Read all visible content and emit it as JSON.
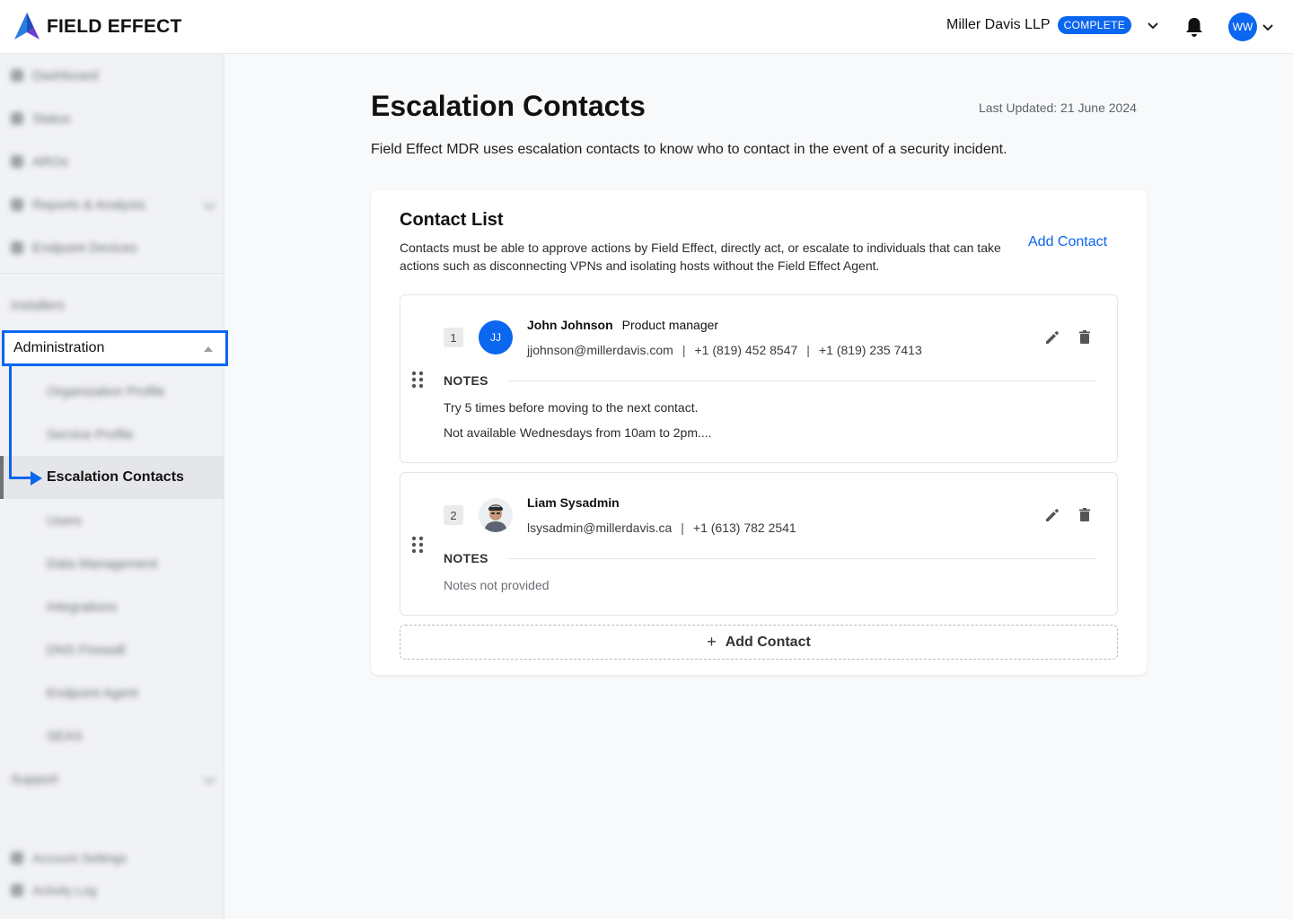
{
  "brand": {
    "name": "FIELD EFFECT"
  },
  "header": {
    "org_name": "Miller Davis LLP",
    "org_status": "COMPLETE",
    "user_initials": "WW",
    "icons": [
      "chevron-down-icon",
      "bell-icon"
    ]
  },
  "sidebar": {
    "top_items": [
      {
        "label": "Dashboard",
        "icon": "grid-icon"
      },
      {
        "label": "Status",
        "icon": "status-icon"
      },
      {
        "label": "AROs",
        "icon": "alert-icon"
      },
      {
        "label": "Reports & Analysis",
        "icon": "report-icon"
      },
      {
        "label": "Endpoint Devices",
        "icon": "device-icon"
      }
    ],
    "installers": "Installers",
    "administration": "Administration",
    "admin_items": [
      {
        "label": "Organization Profile"
      },
      {
        "label": "Service Profile"
      },
      {
        "label": "Escalation Contacts"
      },
      {
        "label": "Users"
      },
      {
        "label": "Data Management"
      },
      {
        "label": "Integrations"
      },
      {
        "label": "DNS Firewall"
      },
      {
        "label": "Endpoint Agent"
      },
      {
        "label": "SEAS"
      }
    ],
    "support": "Support",
    "bottom_items": [
      {
        "label": "Account Settings",
        "icon": "user-icon"
      },
      {
        "label": "Activity Log",
        "icon": "activity-icon"
      }
    ]
  },
  "page": {
    "title": "Escalation Contacts",
    "last_updated": "Last Updated: 21 June 2024",
    "description": "Field Effect MDR uses escalation contacts to know who to contact in the event of a security incident."
  },
  "contact_list": {
    "title": "Contact List",
    "description": "Contacts must be able to approve actions by Field Effect, directly act, or escalate to individuals that can take actions such as disconnecting VPNs and isolating hosts without the Field Effect Agent.",
    "add_link": "Add Contact",
    "add_button": "Add Contact",
    "notes_header": "NOTES",
    "contacts": [
      {
        "index": "1",
        "initials": "JJ",
        "name": "John Johnson",
        "role": "Product manager",
        "email": "jjohnson@millerdavis.com",
        "phone1": "+1 (819) 452 8547",
        "phone2": "+1 (819) 235 7413",
        "notes": [
          "Try 5 times before moving to the next contact.",
          "Not available Wednesdays from 10am to 2pm...."
        ]
      },
      {
        "index": "2",
        "name": "Liam Sysadmin",
        "email": "lsysadmin@millerdavis.ca",
        "phone1": "+1 (613) 782 2541",
        "notes_empty": "Notes not provided"
      }
    ]
  }
}
